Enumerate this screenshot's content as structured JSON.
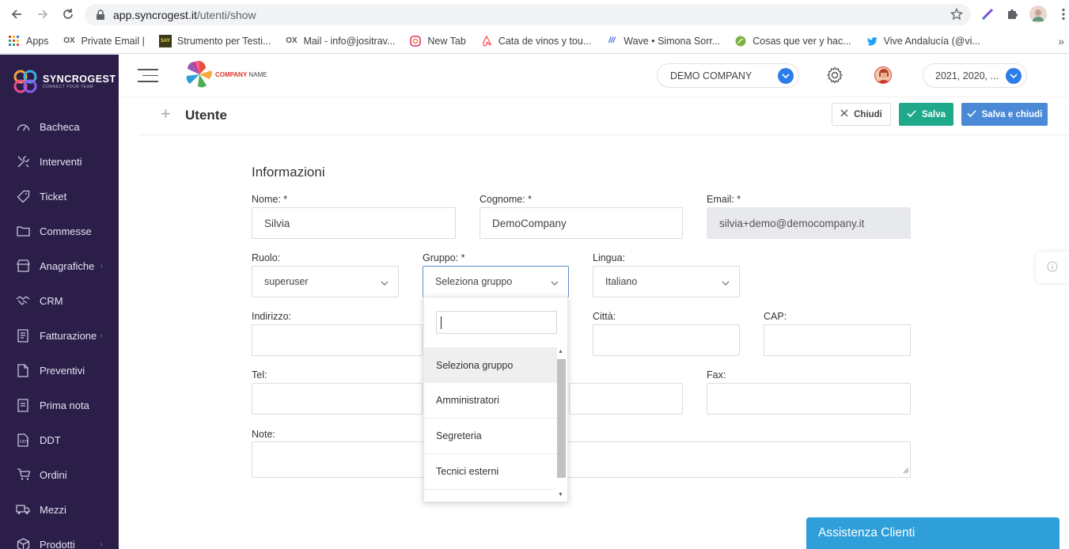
{
  "browser": {
    "url_host": "app.syncrogest.it",
    "url_path": "/utenti/show",
    "bookmarks": [
      {
        "label": "Apps",
        "icon": "apps-grid-icon"
      },
      {
        "label": "Private Email |",
        "icon": "ox-icon"
      },
      {
        "label": "Strumento per Testi...",
        "icon": "say-text-icon"
      },
      {
        "label": "Mail - info@jositrav...",
        "icon": "ox-icon"
      },
      {
        "label": "New Tab",
        "icon": "instagram-icon"
      },
      {
        "label": "Cata de vinos y tou...",
        "icon": "airbnb-icon"
      },
      {
        "label": "Wave • Simona Sorr...",
        "icon": "wave-icon"
      },
      {
        "label": "Cosas que ver y hac...",
        "icon": "leaf-icon"
      },
      {
        "label": "Vive Andalucía (@vi...",
        "icon": "twitter-icon"
      }
    ]
  },
  "sidebar": {
    "brand": "SYNCROGEST",
    "tagline": "CONNECT YOUR TEAM",
    "items": [
      {
        "label": "Bacheca",
        "icon": "dashboard-icon",
        "has_submenu": false
      },
      {
        "label": "Interventi",
        "icon": "tools-icon",
        "has_submenu": false
      },
      {
        "label": "Ticket",
        "icon": "tag-icon",
        "has_submenu": false
      },
      {
        "label": "Commesse",
        "icon": "folder-icon",
        "has_submenu": false
      },
      {
        "label": "Anagrafiche",
        "icon": "store-icon",
        "has_submenu": true
      },
      {
        "label": "CRM",
        "icon": "handshake-icon",
        "has_submenu": false
      },
      {
        "label": "Fatturazione",
        "icon": "invoice-icon",
        "has_submenu": true
      },
      {
        "label": "Preventivi",
        "icon": "document-icon",
        "has_submenu": false
      },
      {
        "label": "Prima nota",
        "icon": "note-icon",
        "has_submenu": false
      },
      {
        "label": "DDT",
        "icon": "ddt-document-icon",
        "has_submenu": false
      },
      {
        "label": "Ordini",
        "icon": "cart-icon",
        "has_submenu": false
      },
      {
        "label": "Mezzi",
        "icon": "truck-icon",
        "has_submenu": false
      },
      {
        "label": "Prodotti",
        "icon": "box-icon",
        "has_submenu": true
      }
    ]
  },
  "header": {
    "company_logo_text": "COMPANY",
    "company_logo_name": "NAME",
    "company_select": "DEMO COMPANY",
    "year_select": "2021, 2020, ..."
  },
  "page": {
    "title": "Utente",
    "buttons": {
      "close": "Chiudi",
      "save": "Salva",
      "save_close": "Salva e chiudi"
    }
  },
  "form": {
    "section_title": "Informazioni",
    "nome": {
      "label": "Nome: *",
      "value": "Silvia"
    },
    "cognome": {
      "label": "Cognome: *",
      "value": "DemoCompany"
    },
    "email": {
      "label": "Email: *",
      "value": "silvia+demo@democompany.it"
    },
    "ruolo": {
      "label": "Ruolo:",
      "value": "superuser"
    },
    "gruppo": {
      "label": "Gruppo: *",
      "value": "Seleziona gruppo"
    },
    "lingua": {
      "label": "Lingua:",
      "value": "Italiano"
    },
    "indirizzo": {
      "label": "Indirizzo:",
      "value": ""
    },
    "citta": {
      "label": "Città:",
      "value": ""
    },
    "cap": {
      "label": "CAP:",
      "value": ""
    },
    "tel": {
      "label": "Tel:",
      "value": ""
    },
    "fax": {
      "label": "Fax:",
      "value": ""
    },
    "note": {
      "label": "Note:",
      "value": ""
    }
  },
  "gruppo_dropdown": {
    "search_value": "",
    "options": [
      "Seleziona gruppo",
      "Amministratori",
      "Segreteria",
      "Tecnici esterni"
    ],
    "highlighted_index": 0
  },
  "assistance": {
    "label": "Assistenza Clienti"
  },
  "colors": {
    "sidebar_bg": "#2b1f4a",
    "save_green": "#1fa98a",
    "save_close_blue": "#4a89d6",
    "accent_blue": "#2b7de9",
    "assist_blue": "#2f9fd9"
  }
}
